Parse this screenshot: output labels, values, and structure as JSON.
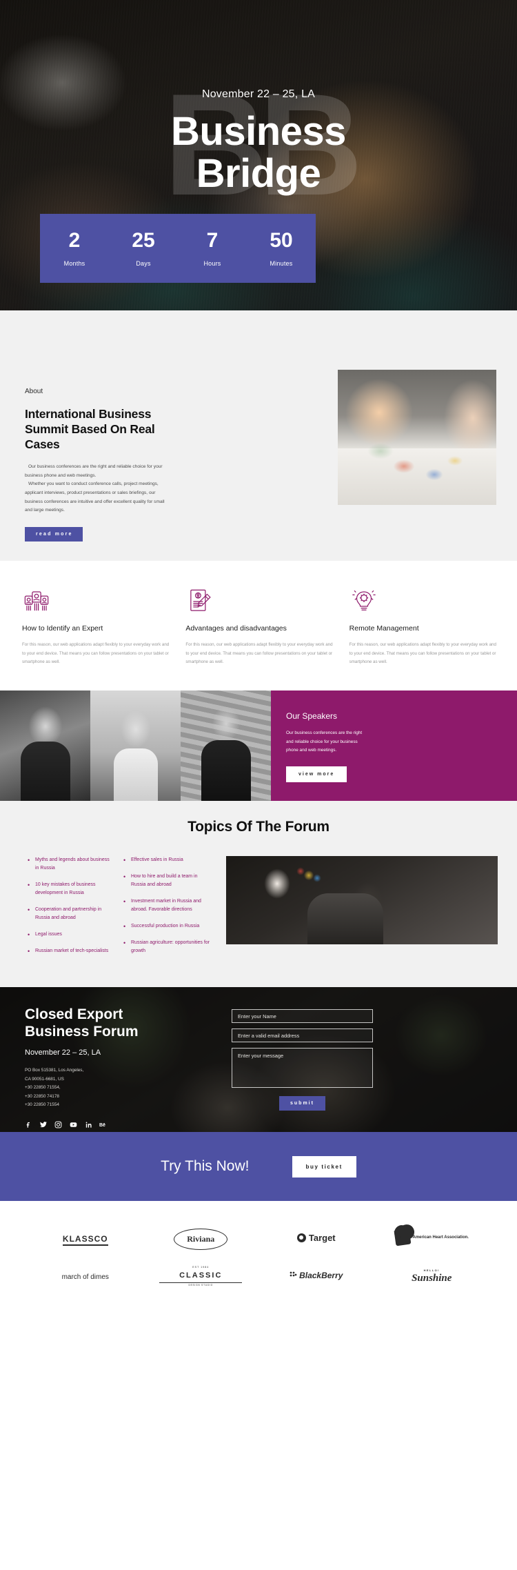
{
  "hero": {
    "watermark": "BB",
    "date": "November 22 – 25, LA",
    "title_line1": "Business",
    "title_line2": "Bridge"
  },
  "countdown": {
    "items": [
      {
        "value": "2",
        "label": "Months"
      },
      {
        "value": "25",
        "label": "Days"
      },
      {
        "value": "7",
        "label": "Hours"
      },
      {
        "value": "50",
        "label": "Minutes"
      }
    ]
  },
  "about": {
    "kicker": "About",
    "heading": "International Business Summit Based On Real Cases",
    "paragraph1": "Our business conferences are the right and reliable choice for your business phone and web meetings.",
    "paragraph2": "Whether you want to conduct conference calls, project meetings, applicant interviews, product presentations or sales briefings, our business conferences are intuitive and offer excellent quality for small and large meetings.",
    "button_label": "read more",
    "image_alt": "business-meeting-photo"
  },
  "features": {
    "body_text": "For this reason, our web applications adapt flexibly to your everyday work and to your end device. That means you can follow presentations on your tablet or smartphone as well.",
    "items": [
      {
        "icon": "experts-group-icon",
        "title": "How to Identify an Expert"
      },
      {
        "icon": "document-pen-icon",
        "title": "Advantages and disadvantages"
      },
      {
        "icon": "lightbulb-gear-icon",
        "title": "Remote Management"
      }
    ]
  },
  "speakers": {
    "title": "Our Speakers",
    "text": "Our business conferences are the right and reliable choice for your business phone and web meetings.",
    "button_label": "view more",
    "photos": [
      "speaker-photo-1",
      "speaker-photo-2",
      "speaker-photo-3"
    ]
  },
  "topics": {
    "title": "Topics Of The Forum",
    "column1": [
      "Myths and legends about business in Russia",
      "10 key mistakes of business development in Russia",
      "Cooperation and partnership in Russia and abroad",
      "Legal issues",
      "Russian market of tech-specialists"
    ],
    "column2": [
      "Effective sales in Russia",
      "How to hire and build a team in Russia and abroad",
      "Investment market in Russia and abroad. Favorable directions",
      "Successful production in Russia",
      "Russian agriculture: opportunities for growth"
    ],
    "image_alt": "forum-audience-photo"
  },
  "contact": {
    "title_line1": "Closed Export",
    "title_line2": "Business Forum",
    "date": "November 22 – 25, LA",
    "address_line1": "PO Box 515381, Los Angeles,",
    "address_line2": "CA 90051-6681, US",
    "phone1": "+30 22850 71554,",
    "phone2": "+30 22850 74178",
    "phone3": "+30 22850 71554",
    "social": [
      "facebook-icon",
      "twitter-icon",
      "instagram-icon",
      "youtube-icon",
      "linkedin-icon",
      "behance-icon"
    ],
    "form": {
      "name_placeholder": "Enter your Name",
      "email_placeholder": "Enter a valid email address",
      "message_placeholder": "Enter your message",
      "submit_label": "submit"
    }
  },
  "cta": {
    "title": "Try This Now!",
    "button_label": "buy ticket"
  },
  "logos": {
    "row1": [
      "KLASSCO",
      "Riviana",
      "Target",
      "American Heart Association."
    ],
    "row2": [
      "march of dimes",
      "CLASSIC",
      "BlackBerry",
      "Sunshine"
    ],
    "classic_top": "EST 1984",
    "classic_bottom": "DESIGN STUDIO",
    "sunshine_top": "HELLO!"
  },
  "colors": {
    "accent_purple": "#4e51a3",
    "accent_magenta": "#8e1a6b",
    "bg_light": "#f1f1f1"
  }
}
